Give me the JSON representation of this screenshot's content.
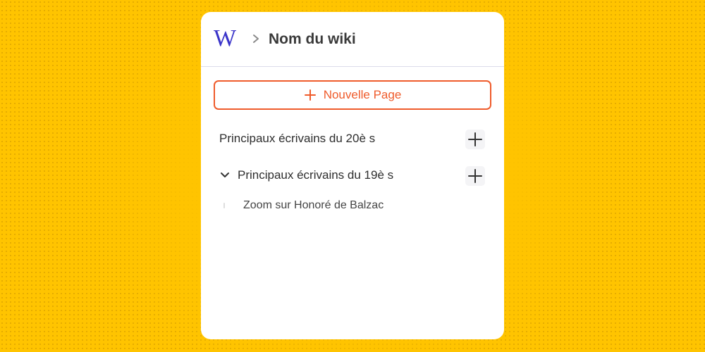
{
  "wiki": {
    "name": "Nom du wiki",
    "logo_letter": "W",
    "brand_color": "#3a34c9"
  },
  "actions": {
    "new_page_label": "Nouvelle Page",
    "accent_color": "#ef5b2b"
  },
  "tree": {
    "items": [
      {
        "label": "Principaux écrivains du 20è s",
        "expanded": false,
        "icons": [
          "plus-icon"
        ]
      },
      {
        "label": "Principaux écrivains du 19è s",
        "expanded": true,
        "icons": [
          "chevron-down-icon",
          "plus-icon"
        ],
        "children": [
          {
            "label": "Zoom sur Honoré de Balzac"
          }
        ]
      }
    ]
  },
  "background_color": "#ffc400"
}
